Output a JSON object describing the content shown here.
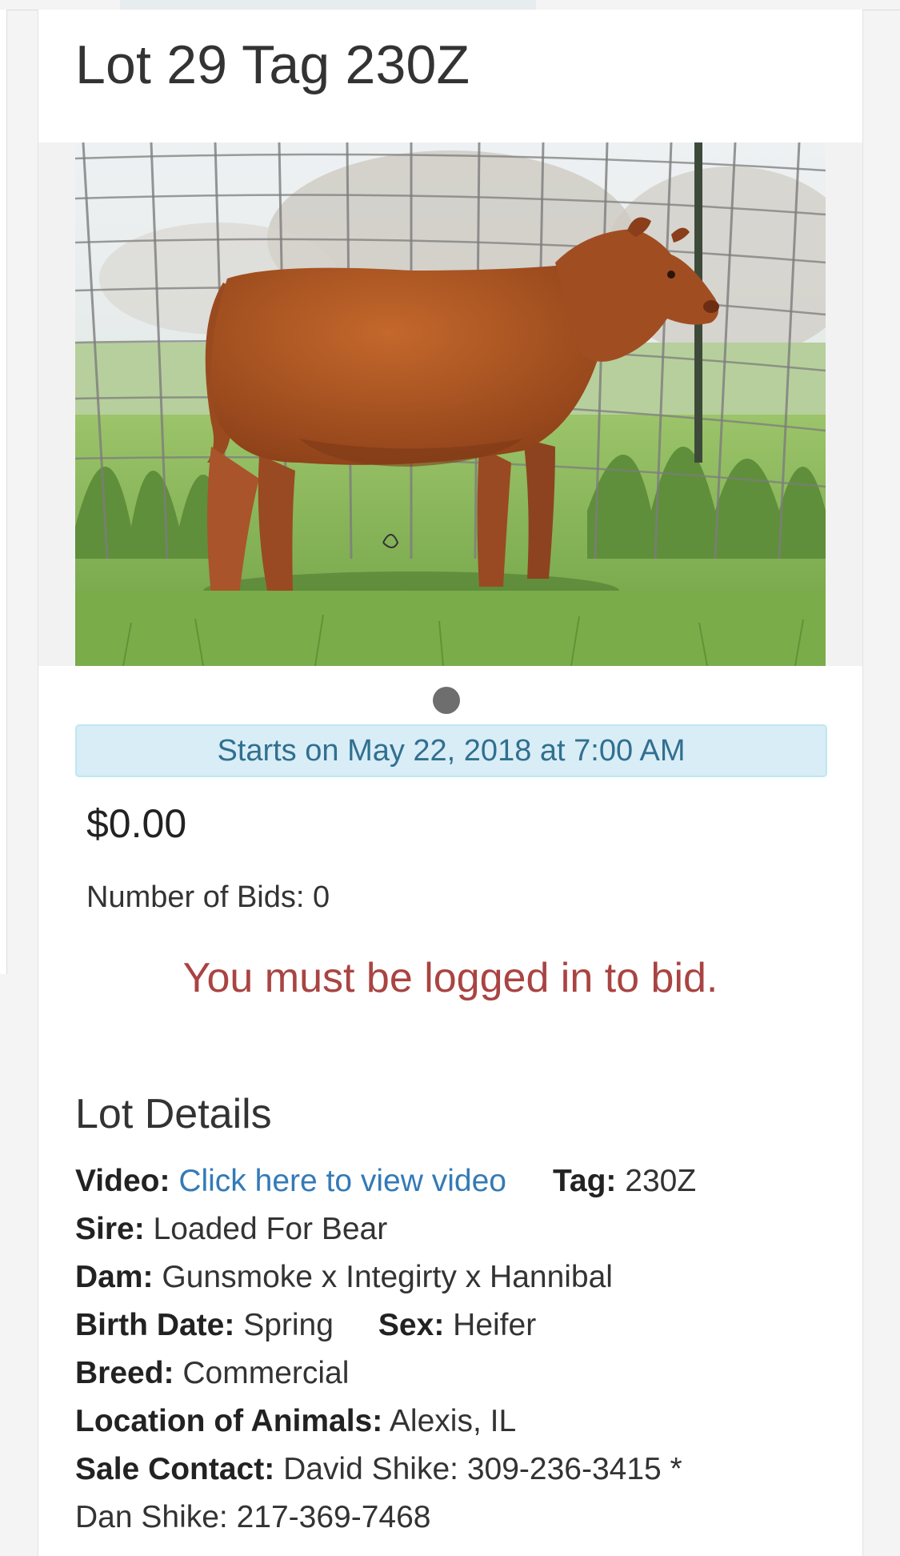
{
  "lot": {
    "title": "Lot 29 Tag 230Z",
    "photo_name": "red heifer standing in grass"
  },
  "auction": {
    "start_text": "Starts on May 22, 2018 at 7:00 AM",
    "price": "$0.00",
    "bids_text": "Number of Bids: 0",
    "login_message": "You must be logged in to bid."
  },
  "details": {
    "heading": "Lot Details",
    "video_label": "Video:",
    "video_link": "Click here to view video",
    "tag_label": "Tag:",
    "tag_value": "230Z",
    "sire_label": "Sire:",
    "sire_value": "Loaded For Bear",
    "dam_label": "Dam:",
    "dam_value": "Gunsmoke x Integirty x Hannibal",
    "birth_label": "Birth Date:",
    "birth_value": "Spring",
    "sex_label": "Sex:",
    "sex_value": "Heifer",
    "breed_label": "Breed:",
    "breed_value": "Commercial",
    "location_label": "Location of Animals:",
    "location_value": "Alexis, IL",
    "contact_label": "Sale Contact:",
    "contact_value": "David Shike: 309-236-3415 *",
    "contact_value_2": "Dan Shike: 217-369-7468"
  },
  "colors": {
    "banner_bg": "#d9edf7",
    "banner_text": "#31708f",
    "link": "#337ab7",
    "warning": "#a94442"
  }
}
